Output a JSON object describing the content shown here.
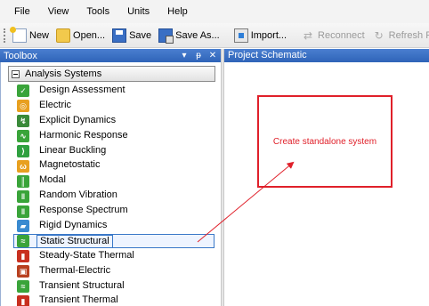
{
  "menu": [
    "File",
    "View",
    "Tools",
    "Units",
    "Help"
  ],
  "toolbar": {
    "new_label": "New",
    "open_label": "Open...",
    "save_label": "Save",
    "save_as_label": "Save As...",
    "import_label": "Import...",
    "reconnect_label": "Reconnect",
    "refresh_label": "Refresh Proje"
  },
  "toolbox": {
    "title": "Toolbox",
    "controls": [
      "▾",
      "ᵽ",
      "✕"
    ],
    "group_label": "Analysis Systems",
    "items": [
      {
        "label": "Design Assessment",
        "icon": "check-icon",
        "color": "#3aa43a",
        "glyph": "✓"
      },
      {
        "label": "Electric",
        "icon": "electric-icon",
        "color": "#e8a020",
        "glyph": "◎"
      },
      {
        "label": "Explicit Dynamics",
        "icon": "explicit-dynamics-icon",
        "color": "#3a8a3a",
        "glyph": "↯"
      },
      {
        "label": "Harmonic Response",
        "icon": "harmonic-response-icon",
        "color": "#3aa43a",
        "glyph": "∿"
      },
      {
        "label": "Linear Buckling",
        "icon": "linear-buckling-icon",
        "color": "#2fa040",
        "glyph": "⟩"
      },
      {
        "label": "Magnetostatic",
        "icon": "magnetostatic-icon",
        "color": "#e8a020",
        "glyph": "ω"
      },
      {
        "label": "Modal",
        "icon": "modal-icon",
        "color": "#3aa43a",
        "glyph": "║"
      },
      {
        "label": "Random Vibration",
        "icon": "random-vibration-icon",
        "color": "#3aa43a",
        "glyph": "‖"
      },
      {
        "label": "Response Spectrum",
        "icon": "response-spectrum-icon",
        "color": "#3aa43a",
        "glyph": "‖"
      },
      {
        "label": "Rigid Dynamics",
        "icon": "rigid-dynamics-icon",
        "color": "#3a8ad0",
        "glyph": "▰"
      },
      {
        "label": "Static Structural",
        "icon": "static-structural-icon",
        "color": "#3aa43a",
        "glyph": "≈",
        "selected": true
      },
      {
        "label": "Steady-State Thermal",
        "icon": "steady-state-thermal-icon",
        "color": "#c83020",
        "glyph": "▮"
      },
      {
        "label": "Thermal-Electric",
        "icon": "thermal-electric-icon",
        "color": "#b84020",
        "glyph": "▣"
      },
      {
        "label": "Transient Structural",
        "icon": "transient-structural-icon",
        "color": "#3aa43a",
        "glyph": "≈"
      },
      {
        "label": "Transient Thermal",
        "icon": "transient-thermal-icon",
        "color": "#c83020",
        "glyph": "▮"
      }
    ]
  },
  "schematic": {
    "title": "Project Schematic",
    "callout_text": "Create standalone system"
  },
  "colors": {
    "header_blue": "#2f64b8",
    "callout_red": "#e0202a",
    "selection_border": "#3a78c8"
  }
}
